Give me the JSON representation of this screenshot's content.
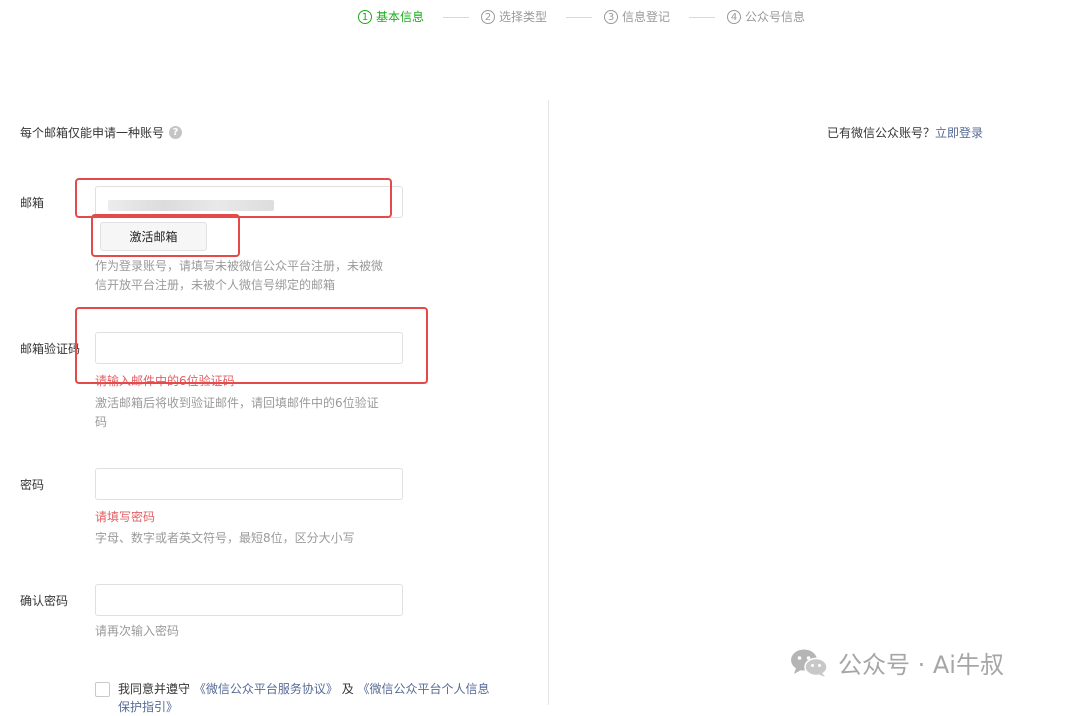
{
  "steps": [
    {
      "num": "1",
      "label": "基本信息"
    },
    {
      "num": "2",
      "label": "选择类型"
    },
    {
      "num": "3",
      "label": "信息登记"
    },
    {
      "num": "4",
      "label": "公众号信息"
    }
  ],
  "note": {
    "text": "每个邮箱仅能申请一种账号",
    "help_icon": "question-circle-icon"
  },
  "login_tip": {
    "text": "已有微信公众账号？",
    "link": "立即登录"
  },
  "email": {
    "label": "邮箱",
    "value": "",
    "activate_button": "激活邮箱",
    "hint": "作为登录账号，请填写未被微信公众平台注册，未被微信开放平台注册，未被个人微信号绑定的邮箱"
  },
  "code": {
    "label": "邮箱验证码",
    "value": "",
    "error": "请输入邮件中的6位验证码",
    "hint": "激活邮箱后将收到验证邮件，请回填邮件中的6位验证码"
  },
  "password": {
    "label": "密码",
    "value": "",
    "error": "请填写密码",
    "hint": "字母、数字或者英文符号，最短8位，区分大小写"
  },
  "confirm": {
    "label": "确认密码",
    "value": "",
    "hint": "请再次输入密码"
  },
  "agreement": {
    "prefix": "我同意并遵守",
    "link1": "《微信公众平台服务协议》",
    "mid": "及",
    "link2": "《微信公众平台个人信息保护指引》"
  },
  "watermark": {
    "text": "公众号 · Ai牛叔",
    "icon": "wechat-icon"
  },
  "colors": {
    "accent": "#1aad19",
    "link": "#576b95",
    "error": "#e15f63",
    "annotation": "#e44a4a"
  }
}
